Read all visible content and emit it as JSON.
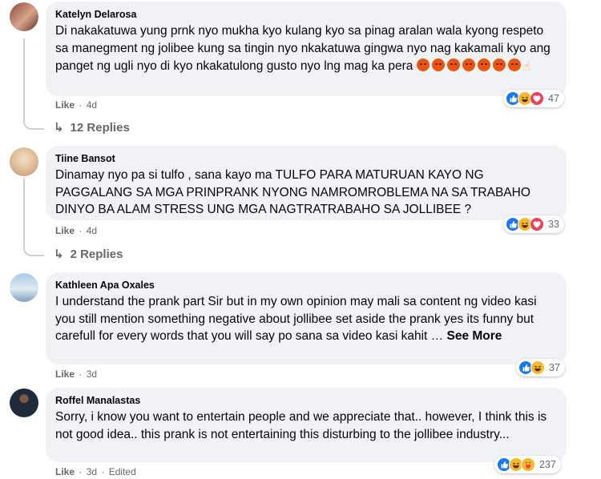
{
  "comments": [
    {
      "author": "Katelyn Delarosa",
      "text": "Di nakakatuwa yung prnk nyo mukha kyo kulang kyo sa pinag aralan wala kyong respeto sa manegment ng jolibee kung sa tingin nyo nkakatuwa gingwa nyo nag kakamali kyo ang panget ng ugli nyo di kyo nkakatulong gusto nyo lng mag ka pera",
      "emoji_note": "angry-face x7, hand",
      "like_label": "Like",
      "time": "4d",
      "edited": "",
      "reactions": [
        "like",
        "haha",
        "heart"
      ],
      "reaction_count": "47",
      "replies": "12 Replies"
    },
    {
      "author": "Tiine Bansot",
      "text": "Dinamay nyo pa si tulfo , sana kayo ma TULFO PARA MATURUAN KAYO NG PAGGALANG SA MGA PRINPRANK NYONG NAMROMROBLEMA NA SA TRABAHO DINYO BA ALAM STRESS UNG MGA NAGTRATRABAHO SA JOLLIBEE ?",
      "like_label": "Like",
      "time": "4d",
      "edited": "",
      "reactions": [
        "like",
        "haha",
        "heart"
      ],
      "reaction_count": "33",
      "replies": "2 Replies"
    },
    {
      "author": "Kathleen Apa Oxales",
      "text": "I understand the prank part Sir but in my own opinion may mali sa content ng video kasi you still mention something negative about jollibee set aside the prank yes its funny but carefull for every words that you will say po sana sa video kasi kahit …",
      "see_more": "See More",
      "like_label": "Like",
      "time": "3d",
      "edited": "",
      "reactions": [
        "like",
        "haha"
      ],
      "reaction_count": "37"
    },
    {
      "author": "Roffel Manalastas",
      "text": "Sorry, i know you want to entertain people and we appreciate that.. however, I think this is not good idea.. this prank is not entertaining this disturbing to the jollibee industry...",
      "like_label": "Like",
      "time": "3d",
      "edited": "Edited",
      "reactions": [
        "like",
        "haha",
        "care"
      ],
      "reaction_count": "237"
    }
  ],
  "separator": "·",
  "colors": {
    "bubble": "#f0f2f5",
    "meta": "#65676b",
    "like": "#1877f2",
    "haha": "#f7b928",
    "heart": "#f33e58",
    "angry": "#e9550c"
  }
}
